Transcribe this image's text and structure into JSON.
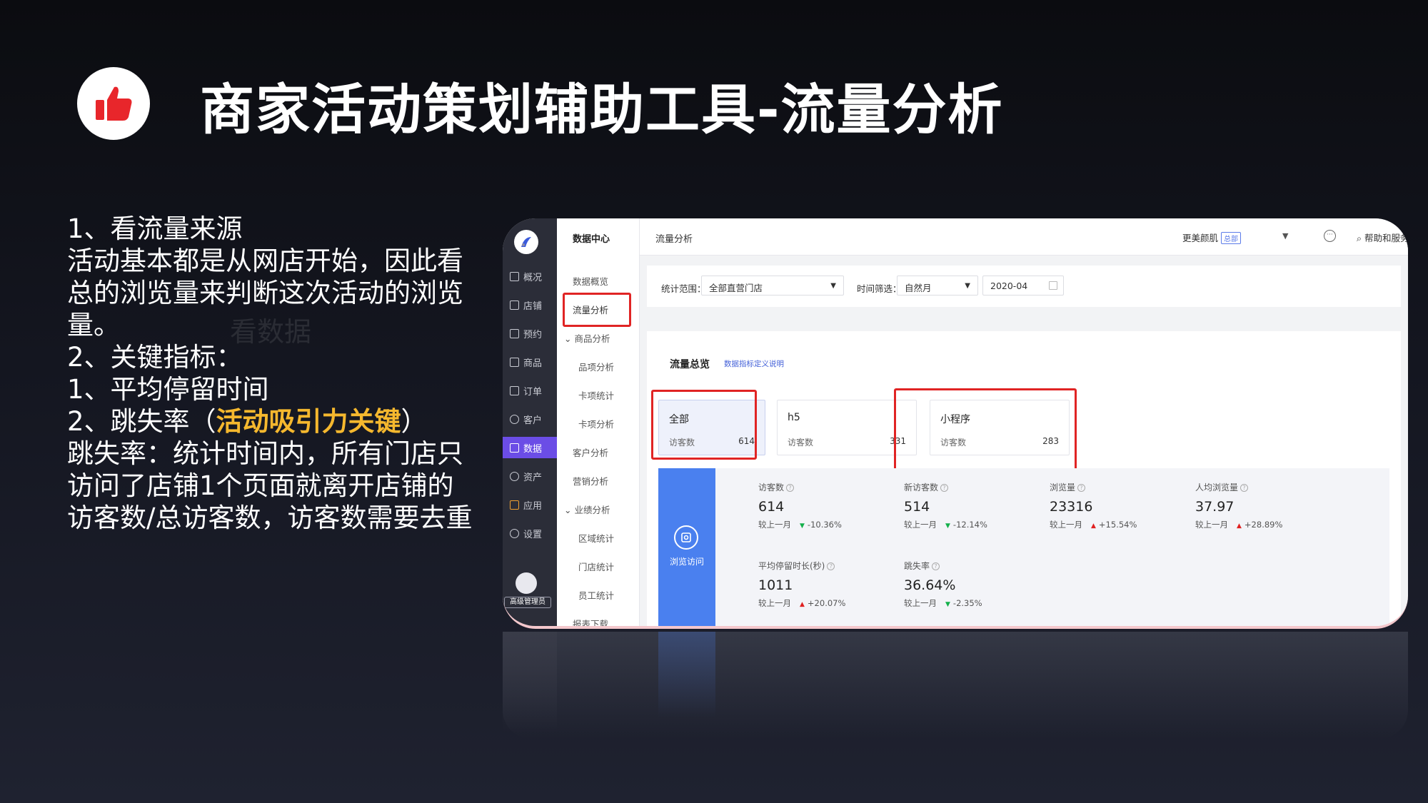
{
  "slide": {
    "title": "商家活动策划辅助工具-流量分析",
    "ghost_text": "看数据",
    "body_lines": [
      "1、看流量来源",
      "活动基本都是从网店开始，因此看",
      "总的浏览量来判断这次活动的浏览",
      "量。",
      "2、关键指标：",
      "1、平均停留时间"
    ],
    "bounce_line": {
      "prefix": "2、跳失率（",
      "highlight": "活动吸引力关键",
      "suffix": "）"
    },
    "tail_lines": [
      "跳失率：统计时间内，所有门店只",
      "访问了店铺1个页面就离开店铺的",
      "访客数/总访客数，访客数需要去重"
    ],
    "colors": {
      "highlight": "#f5b82e",
      "logo_icon": "#e8262b"
    }
  },
  "app": {
    "nav": [
      {
        "label": "概况",
        "icon": "overview-icon"
      },
      {
        "label": "店铺",
        "icon": "store-icon"
      },
      {
        "label": "预约",
        "icon": "booking-icon"
      },
      {
        "label": "商品",
        "icon": "goods-icon"
      },
      {
        "label": "订单",
        "icon": "order-icon"
      },
      {
        "label": "客户",
        "icon": "customer-icon"
      },
      {
        "label": "数据",
        "icon": "chart-icon",
        "active": true
      },
      {
        "label": "资产",
        "icon": "asset-icon"
      },
      {
        "label": "应用",
        "icon": "apps-icon"
      },
      {
        "label": "设置",
        "icon": "settings-icon"
      }
    ],
    "admin_label": "高级管理员",
    "subnav": {
      "title": "数据中心",
      "items": [
        "数据概览",
        "流量分析",
        "商品分析",
        "品项分析",
        "卡项统计",
        "卡项分析",
        "客户分析",
        "营销分析",
        "业绩分析",
        "区域统计",
        "门店统计",
        "员工统计",
        "报表下载"
      ]
    },
    "topbar": {
      "breadcrumb": "流量分析",
      "store": "更美颜肌",
      "store_tag": "总部",
      "help": "帮助和服务"
    },
    "filter": {
      "scope_label": "统计范围：",
      "scope_value": "全部直营门店",
      "time_label": "时间筛选：",
      "time_type": "自然月",
      "time_value": "2020-04"
    },
    "overview": {
      "title": "流量总览",
      "link": "数据指标定义说明",
      "cards": [
        {
          "name": "全部",
          "label": "访客数",
          "value": "614"
        },
        {
          "name": "h5",
          "label": "访客数",
          "value": "331"
        },
        {
          "name": "小程序",
          "label": "访客数",
          "value": "283"
        }
      ],
      "section_label": "浏览访问",
      "metrics": [
        {
          "label": "访客数",
          "value": "614",
          "compare": "较上一月",
          "trend": "down",
          "change": "-10.36%"
        },
        {
          "label": "新访客数",
          "value": "514",
          "compare": "较上一月",
          "trend": "down",
          "change": "-12.14%"
        },
        {
          "label": "浏览量",
          "value": "23316",
          "compare": "较上一月",
          "trend": "up",
          "change": "+15.54%"
        },
        {
          "label": "人均浏览量",
          "value": "37.97",
          "compare": "较上一月",
          "trend": "up",
          "change": "+28.89%"
        },
        {
          "label": "平均停留时长(秒)",
          "value": "1011",
          "compare": "较上一月",
          "trend": "up",
          "change": "+20.07%"
        },
        {
          "label": "跳失率",
          "value": "36.64%",
          "compare": "较上一月",
          "trend": "down",
          "change": "-2.35%"
        }
      ]
    }
  }
}
